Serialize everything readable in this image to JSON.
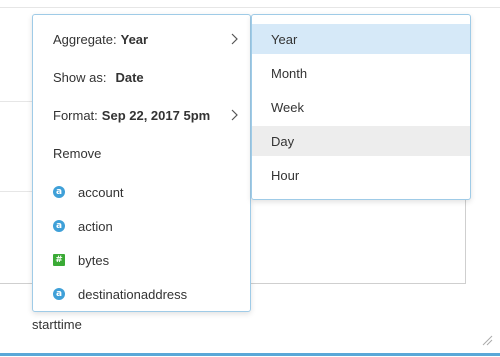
{
  "menu": {
    "aggregate": {
      "label": "Aggregate:",
      "value": "Year"
    },
    "show_as": {
      "label": "Show as:",
      "value": "Date"
    },
    "format": {
      "label": "Format:",
      "value": "Sep 22, 2017 5pm"
    },
    "remove": {
      "label": "Remove"
    },
    "fields": [
      {
        "badge": "a",
        "type": "string",
        "name": "account"
      },
      {
        "badge": "a",
        "type": "string",
        "name": "action"
      },
      {
        "badge": "#",
        "type": "number",
        "name": "bytes"
      },
      {
        "badge": "a",
        "type": "string",
        "name": "destinationaddress"
      }
    ]
  },
  "submenu": {
    "items": [
      {
        "label": "Year",
        "state": "selected"
      },
      {
        "label": "Month",
        "state": ""
      },
      {
        "label": "Week",
        "state": ""
      },
      {
        "label": "Day",
        "state": "hovered"
      },
      {
        "label": "Hour",
        "state": ""
      }
    ]
  },
  "background": {
    "field_label": "starttime"
  },
  "colors": {
    "menu_border": "#9fcbe7",
    "selected_bg": "#d6e9f8",
    "hover_bg": "#ededed",
    "string_badge": "#3fa0d8",
    "number_badge": "#3aaa35",
    "accent": "#5aa8d8"
  }
}
